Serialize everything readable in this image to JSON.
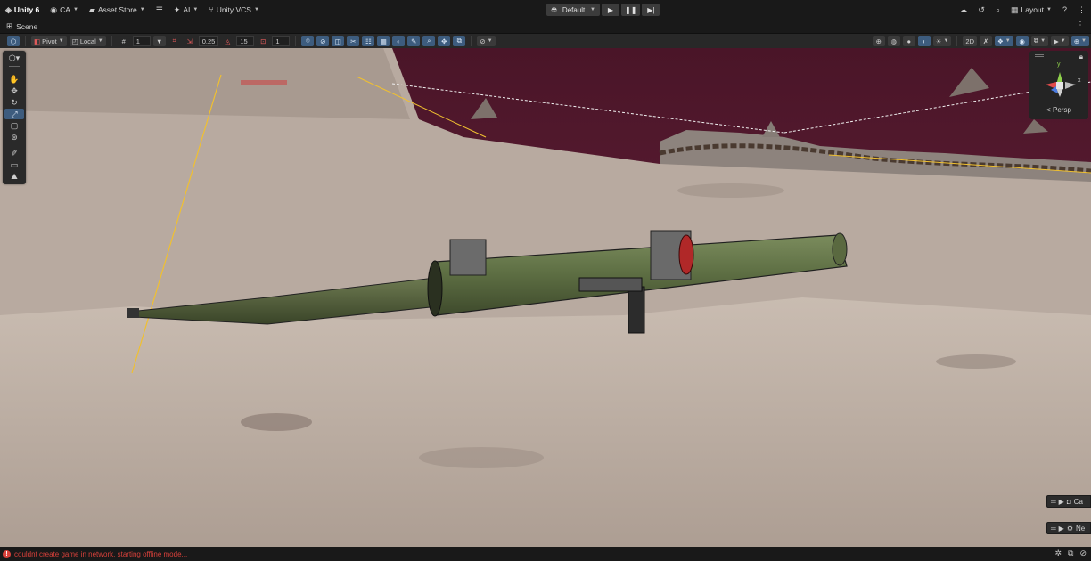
{
  "topbar": {
    "brand": "Unity 6",
    "account": "CA",
    "asset_store": "Asset Store",
    "ai": "AI",
    "vcs": "Unity VCS",
    "layout_mode": "Default",
    "layout_menu": "Layout"
  },
  "scene_tab": {
    "label": "Scene"
  },
  "scene_toolbar": {
    "pivot": "Pivot",
    "space": "Local",
    "grid_snap": "1",
    "move_snap": "0.25",
    "rotate_snap": "15",
    "scale_snap": "1",
    "snap_2d": "2D"
  },
  "gizmo": {
    "projection": "< Persp",
    "y_axis": "y",
    "x_axis": "x"
  },
  "overlays": {
    "panel_1": "Ca",
    "panel_2": "Ne"
  },
  "console": {
    "message": "couldnt create game in network, starting offline mode..."
  },
  "icons": {
    "play": "play-icon",
    "pause": "pause-icon",
    "step": "step-icon",
    "hand": "hand-tool-icon",
    "move": "move-tool-icon",
    "rotate": "rotate-tool-icon",
    "scale": "scale-tool-icon",
    "rect": "rect-tool-icon",
    "transform": "transform-tool-icon"
  },
  "colors": {
    "accent": "#3d5c7e",
    "error": "#d9413b",
    "sky": "#5e1c34",
    "terrain": "#bcaea3",
    "launcher": "#5f7145"
  }
}
